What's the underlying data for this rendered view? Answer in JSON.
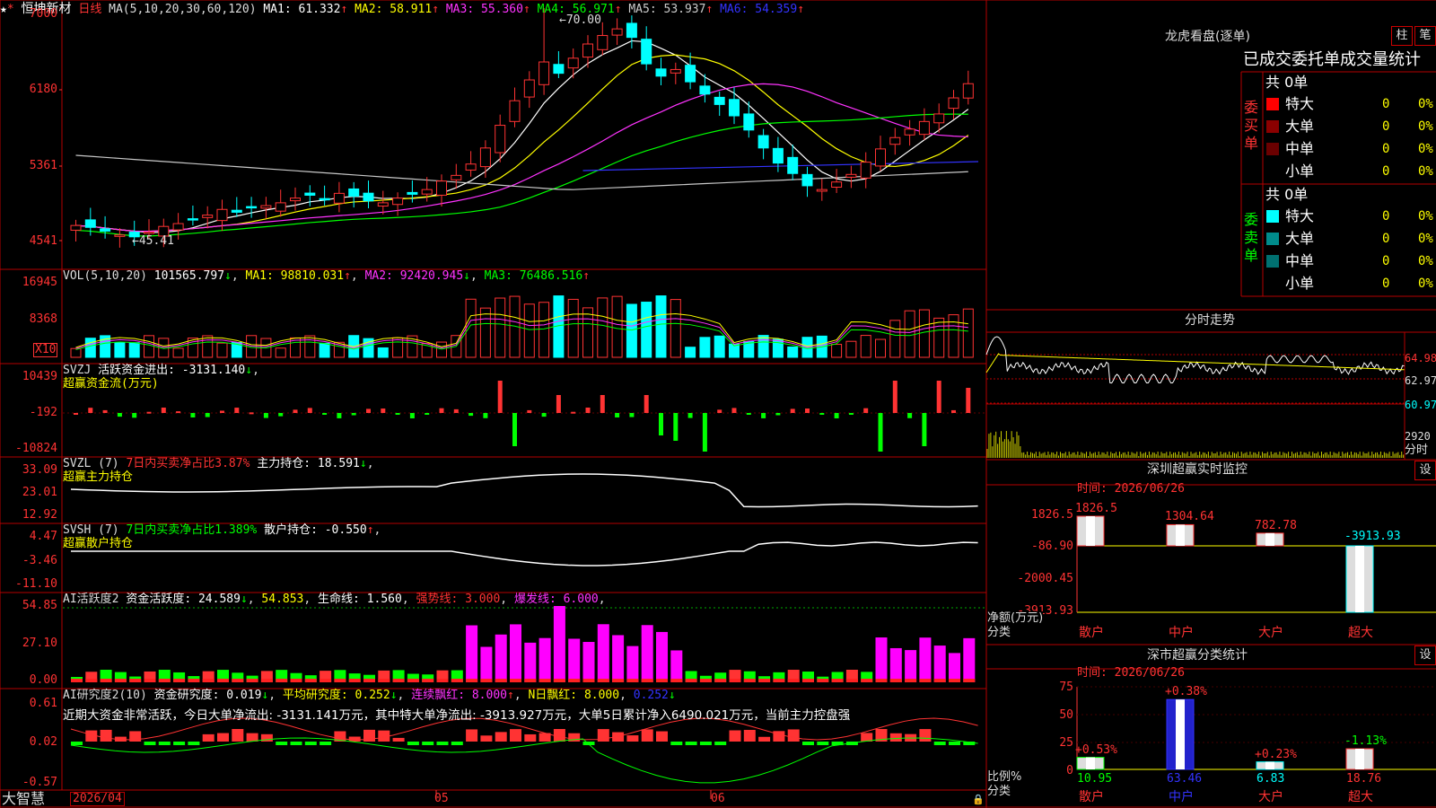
{
  "colors": {
    "up": "#ff3333",
    "down": "#00ffff",
    "frame": "#b40000",
    "ma1": "#ffffff",
    "ma2": "#ffff00",
    "ma3": "#ff33ff",
    "ma4": "#00ff00",
    "ma5": "#c8c8c8",
    "ma6": "#3333ff",
    "green": "#00ff00",
    "magenta": "#ff00ff",
    "yellow": "#ffff00"
  },
  "main": {
    "star": "★",
    "pin": "*",
    "stock_name": "恒坤新材",
    "period": "日线",
    "ma_params": "MA(5,10,20,30,60,120)",
    "ma": [
      {
        "label": "MA1: 61.332",
        "arrow": "↑"
      },
      {
        "label": "MA2: 58.911",
        "arrow": "↑"
      },
      {
        "label": "MA3: 55.360",
        "arrow": "↑"
      },
      {
        "label": "MA4: 56.971",
        "arrow": "↑"
      },
      {
        "label": "MA5: 53.937",
        "arrow": "↑"
      },
      {
        "label": "MA6: 54.359",
        "arrow": "↑"
      }
    ],
    "y_ticks": [
      "7000",
      "6180",
      "5361",
      "4541"
    ],
    "high_label": "70.00",
    "low_label": "45.41"
  },
  "vol": {
    "title": "VOL(5,10,20)",
    "value": "101565.797",
    "v_arrow": "↓",
    "ma1": "MA1: 98810.031",
    "ma1_arrow": "↑",
    "ma2": "MA2: 92420.945",
    "ma2_arrow": "↓",
    "ma3": "MA3: 76486.516",
    "ma3_arrow": "↑",
    "y_ticks": [
      "16945",
      "8368"
    ],
    "x10": "X10"
  },
  "svzj": {
    "title": "SVZJ",
    "label": "活跃资金进出: -3131.140",
    "arrow": "↓",
    "sub": "超赢资金流(万元)",
    "y_ticks": [
      "10439",
      "-192",
      "-10824"
    ]
  },
  "svzl": {
    "title": "SVZL (7)",
    "pct": "7日内买卖净占比3.87%",
    "label": "主力持仓: 18.591",
    "arrow": "↓",
    "sub": "超赢主力持仓",
    "y_ticks": [
      "33.09",
      "23.01",
      "12.92"
    ]
  },
  "svsh": {
    "title": "SVSH (7)",
    "pct": "7日内买卖净占比1.389%",
    "label": "散户持仓: -0.550",
    "arrow": "↑",
    "sub": "超赢散户持仓",
    "y_ticks": [
      "4.47",
      "-3.46",
      "-11.10"
    ]
  },
  "ai1": {
    "title": "AI活跃度2",
    "label": "资金活跃度: 24.589",
    "arrow": "↓",
    "v2": "54.853",
    "v3": "生命线: 1.560",
    "v4": "强势线: 3.000",
    "v5": "爆发线: 6.000",
    "y_ticks": [
      "54.85",
      "27.10",
      "0.00"
    ]
  },
  "ai2": {
    "title": "AI研究度2(10)",
    "label": "资金研究度: 0.019",
    "arrow": "↓",
    "v2": "平均研究度: 0.252",
    "v2_arrow": "↓",
    "v3": "连续飘红: 8.000",
    "v3_arrow": "↑",
    "v4": "N日飘红: 8.000",
    "v5": "0.252",
    "v5_arrow": "↓",
    "summary": "近期大资金非常活跃，今日大单净流出: -3131.141万元，其中特大单净流出: -3913.927万元，大单5日累计净入6490.021万元，当前主力控盘强",
    "y_ticks": [
      "0.61",
      "0.02",
      "-0.57"
    ]
  },
  "bottom": {
    "logo": "大智慧",
    "date": "2026/04",
    "m1": "05",
    "m2": "06"
  },
  "lhb": {
    "title": "龙虎看盘(逐单)",
    "btn_bar": "柱",
    "btn_pen": "笔",
    "tabs": "已成交委托单成交量统计",
    "buy": {
      "side": "委买单",
      "total": "共 0单",
      "rows": [
        {
          "name": "特大",
          "count": "0",
          "pct": "0%"
        },
        {
          "name": "大单",
          "count": "0",
          "pct": "0%"
        },
        {
          "name": "中单",
          "count": "0",
          "pct": "0%"
        },
        {
          "name": "小单",
          "count": "0",
          "pct": "0%"
        }
      ]
    },
    "sell": {
      "side": "委卖单",
      "total": "共 0单",
      "rows": [
        {
          "name": "特大",
          "count": "0",
          "pct": "0%"
        },
        {
          "name": "大单",
          "count": "0",
          "pct": "0%"
        },
        {
          "name": "中单",
          "count": "0",
          "pct": "0%"
        },
        {
          "name": "小单",
          "count": "0",
          "pct": "0%"
        }
      ]
    }
  },
  "fenshi": {
    "title": "分时走势",
    "p_hi": "64.98",
    "p_mid": "62.97",
    "p_lo": "60.97",
    "vol": "2920",
    "fen": "分时"
  },
  "monitor": {
    "title": "深圳超赢实时监控",
    "btn": "设",
    "time": "时间: 2026/06/26",
    "y_ticks": [
      "1826.5",
      "-86.90",
      "-2000.45",
      "-3913.93"
    ],
    "net": "净额(万元)",
    "cat": "分类",
    "bars": [
      {
        "name": "散户",
        "value": "1826.5"
      },
      {
        "name": "中户",
        "value": "1304.64"
      },
      {
        "name": "大户",
        "value": "782.78"
      },
      {
        "name": "超大",
        "value": "-3913.93"
      }
    ]
  },
  "classify": {
    "title": "深市超赢分类统计",
    "btn": "设",
    "time": "时间: 2026/06/26",
    "y_ticks": [
      "75",
      "50",
      "25",
      "0"
    ],
    "ratio": "比例%",
    "cat": "分类",
    "bars": [
      {
        "name": "散户",
        "value": "10.95",
        "change": "+0.53%"
      },
      {
        "name": "中户",
        "value": "63.46",
        "change": "+0.38%"
      },
      {
        "name": "大户",
        "value": "6.83",
        "change": "+0.23%"
      },
      {
        "name": "超大",
        "value": "18.76",
        "change": "-1.13%"
      }
    ]
  }
}
